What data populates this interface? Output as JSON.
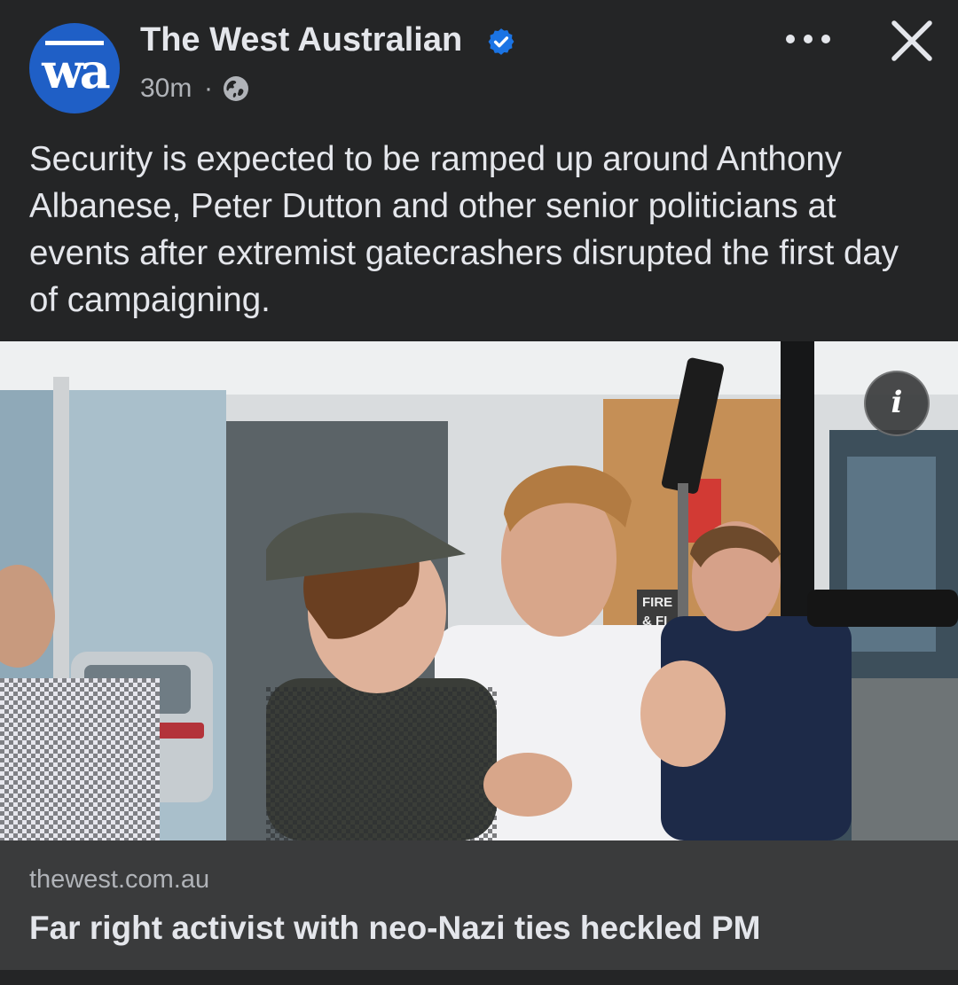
{
  "post": {
    "page_name": "The West Australian",
    "avatar_glyph": "wa",
    "verified_icon": "verified-badge-icon",
    "time": "30m",
    "separator": "·",
    "audience_icon": "globe-icon",
    "message": "Security is expected to be ramped up around Anthony Albanese, Peter Dutton and other senior politicians at events after extremist gatecrashers disrupted the first day of campaigning.",
    "more_icon": "more-horizontal-icon",
    "close_icon": "close-icon",
    "info_icon": "info-icon",
    "info_glyph": "i",
    "photo_signage": "FIRE & FI"
  },
  "link_preview": {
    "domain": "thewest.com.au",
    "title": "Far right activist with neo-Nazi ties heckled PM"
  },
  "colors": {
    "background": "#242526",
    "link_box": "#3a3b3c",
    "text_primary": "#e4e6eb",
    "text_secondary": "#b0b3b8",
    "verified_blue": "#1b74e4",
    "avatar_blue": "#1f5fc6"
  }
}
